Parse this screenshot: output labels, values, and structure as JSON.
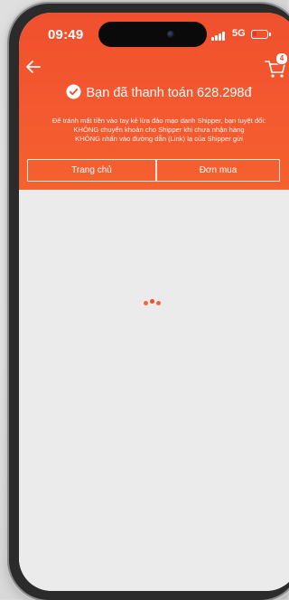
{
  "status_bar": {
    "time": "09:49",
    "network": "5G",
    "battery_level": 0.25,
    "battery_color": "#e3342f"
  },
  "nav": {
    "back_icon": "arrow-left-icon",
    "cart_icon": "shopping-cart-icon",
    "cart_badge": "4"
  },
  "success": {
    "icon": "check-circle-icon",
    "message": "Bạn đã thanh toán 628.298đ"
  },
  "warning": {
    "line1": "Để tránh mất tiền vào tay kẻ lừa đảo mạo danh Shipper, bạn tuyệt đối:",
    "line2": "KHÔNG chuyển khoản cho Shipper khi chưa nhận hàng",
    "line3": "KHÔNG nhấn vào đường dẫn (Link) lạ của Shipper gửi"
  },
  "buttons": {
    "home_label": "Trang chủ",
    "orders_label": "Đơn mua"
  },
  "content": {
    "loading_indicator": "loading-dots-icon"
  },
  "colors": {
    "brand": "#ee4d2d",
    "header_gradient_top": "#f0502e",
    "header_gradient_bottom": "#f5612f",
    "background": "#ebebeb"
  }
}
